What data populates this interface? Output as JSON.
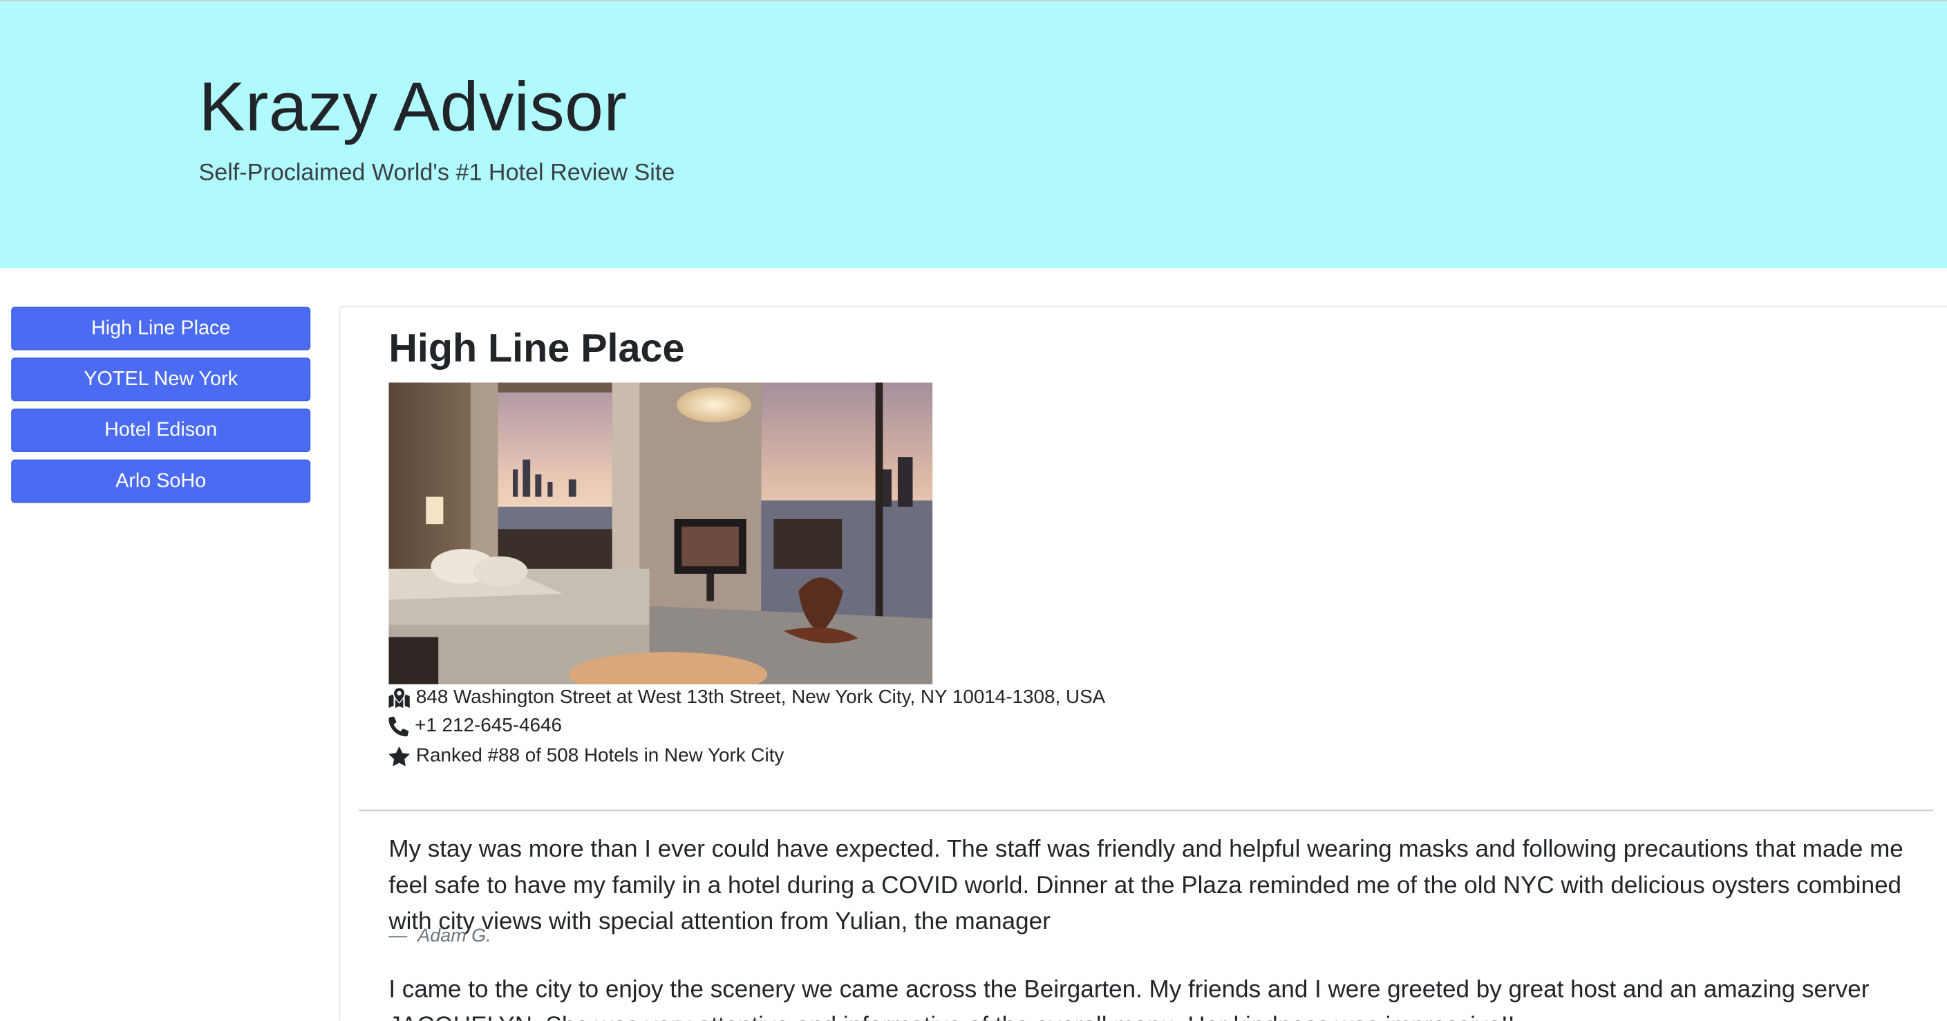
{
  "header": {
    "title": "Krazy Advisor",
    "subtitle": "Self-Proclaimed World's #1 Hotel Review Site",
    "background_color": "#b0fafe"
  },
  "sidebar": {
    "button_color": "#4b6cf2",
    "items": [
      {
        "label": "High Line Place"
      },
      {
        "label": "YOTEL New York"
      },
      {
        "label": "Hotel Edison"
      },
      {
        "label": "Arlo SoHo"
      }
    ]
  },
  "hotel": {
    "name": "High Line Place",
    "address": "848 Washington Street at West 13th Street, New York City, NY 10014-1308, USA",
    "phone": "+1 212-645-4646",
    "ranking": "Ranked #88 of 508 Hotels in New York City",
    "icons": {
      "address": "map-marked-icon",
      "phone": "phone-icon",
      "ranking": "star-icon"
    }
  },
  "reviews": [
    {
      "text": "My stay was more than I ever could have expected. The staff was friendly and helpful wearing masks and following precautions that made me feel safe to have my family in a hotel during a COVID world. Dinner at the Plaza reminded me of the old NYC with delicious oysters combined with city views with special attention from Yulian, the manager",
      "author": "Adam G."
    },
    {
      "text": "I came to the city to enjoy the scenery we came across the Beirgarten. My friends and I were greeted by great host and an amazing server JACQUELYN. She was very attentive and informative of the overall menu. Her kindness was impressive!!",
      "author": ""
    }
  ]
}
